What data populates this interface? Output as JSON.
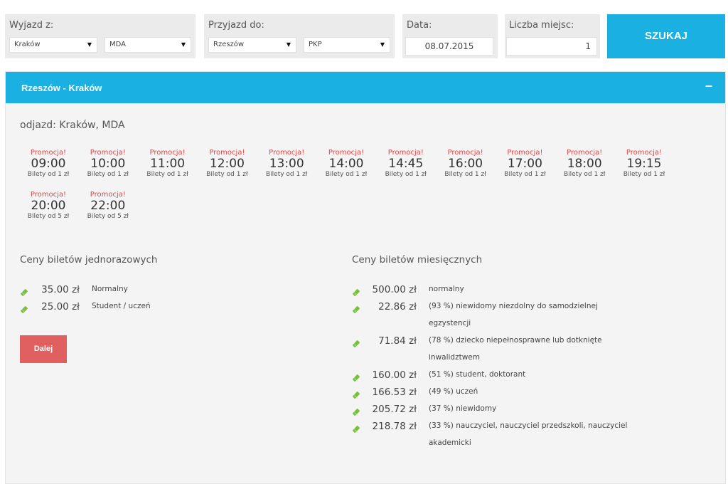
{
  "search": {
    "from_label": "Wyjazd z:",
    "from_city": "Kraków",
    "from_station": "MDA",
    "to_label": "Przyjazd do:",
    "to_city": "Rzeszów",
    "to_station": "PKP",
    "date_label": "Data:",
    "date_value": "08.07.2015",
    "seats_label": "Liczba miejsc:",
    "seats_value": "1",
    "search_button": "SZUKAJ"
  },
  "route": {
    "title": "Rzeszów - Kraków",
    "collapse_symbol": "–",
    "departure": "odjazd: Kraków, MDA"
  },
  "departures": [
    {
      "promo": "Promocja!",
      "time": "09:00",
      "price": "Bilety od 1 zł"
    },
    {
      "promo": "Promocja!",
      "time": "10:00",
      "price": "Bilety od 1 zł"
    },
    {
      "promo": "Promocja!",
      "time": "11:00",
      "price": "Bilety od 1 zł"
    },
    {
      "promo": "Promocja!",
      "time": "12:00",
      "price": "Bilety od 1 zł"
    },
    {
      "promo": "Promocja!",
      "time": "13:00",
      "price": "Bilety od 1 zł"
    },
    {
      "promo": "Promocja!",
      "time": "14:00",
      "price": "Bilety od 1 zł"
    },
    {
      "promo": "Promocja!",
      "time": "14:45",
      "price": "Bilety od 1 zł"
    },
    {
      "promo": "Promocja!",
      "time": "16:00",
      "price": "Bilety od 1 zł"
    },
    {
      "promo": "Promocja!",
      "time": "17:00",
      "price": "Bilety od 1 zł"
    },
    {
      "promo": "Promocja!",
      "time": "18:00",
      "price": "Bilety od 1 zł"
    },
    {
      "promo": "Promocja!",
      "time": "19:15",
      "price": "Bilety od 1 zł"
    },
    {
      "promo": "Promocja!",
      "time": "20:00",
      "price": "Bilety od 5 zł"
    },
    {
      "promo": "Promocja!",
      "time": "22:00",
      "price": "Bilety od 5 zł"
    }
  ],
  "single_tickets": {
    "title": "Ceny biletów jednorazowych",
    "items": [
      {
        "amount": "35.00 zł",
        "label": "Normalny"
      },
      {
        "amount": "25.00 zł",
        "label": "Student / uczeń"
      }
    ]
  },
  "monthly_tickets": {
    "title": "Ceny biletów miesięcznych",
    "items": [
      {
        "amount": "500.00 zł",
        "line1": "normalny",
        "line2": ""
      },
      {
        "amount": "22.86 zł",
        "line1": "(93 %) niewidomy niezdolny do samodzielnej",
        "line2": "egzystencji"
      },
      {
        "amount": "71.84 zł",
        "line1": "(78 %) dziecko niepełnosprawne lub dotknięte",
        "line2": "inwalidztwem"
      },
      {
        "amount": "160.00 zł",
        "line1": "(51 %) student, doktorant",
        "line2": ""
      },
      {
        "amount": "166.53 zł",
        "line1": "(49 %) uczeń",
        "line2": ""
      },
      {
        "amount": "205.72 zł",
        "line1": "(37 %) niewidomy",
        "line2": ""
      },
      {
        "amount": "218.78 zł",
        "line1": "(33 %) nauczyciel, nauczyciel przedszkoli, nauczyciel",
        "line2": "akademicki"
      }
    ]
  },
  "next_button": "Dalej",
  "colors": {
    "accent": "#1ab0e1",
    "promo": "#e64545",
    "next_button": "#e0605f",
    "ticket_icon": "#7bbf3f"
  },
  "icons": {
    "ticket": "ticket-icon",
    "dropdown": "chevron-down-icon"
  }
}
